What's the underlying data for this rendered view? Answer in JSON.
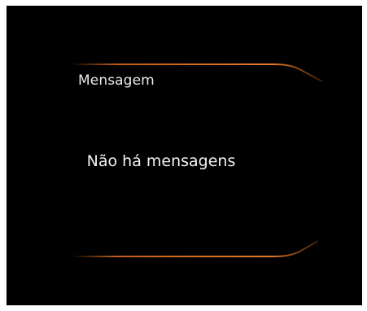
{
  "header": {
    "title": "Mensagem"
  },
  "main": {
    "empty_message": "Não há mensagens"
  },
  "colors": {
    "background": "#000000",
    "accent": "#e07020",
    "text": "#f2f2f2"
  }
}
